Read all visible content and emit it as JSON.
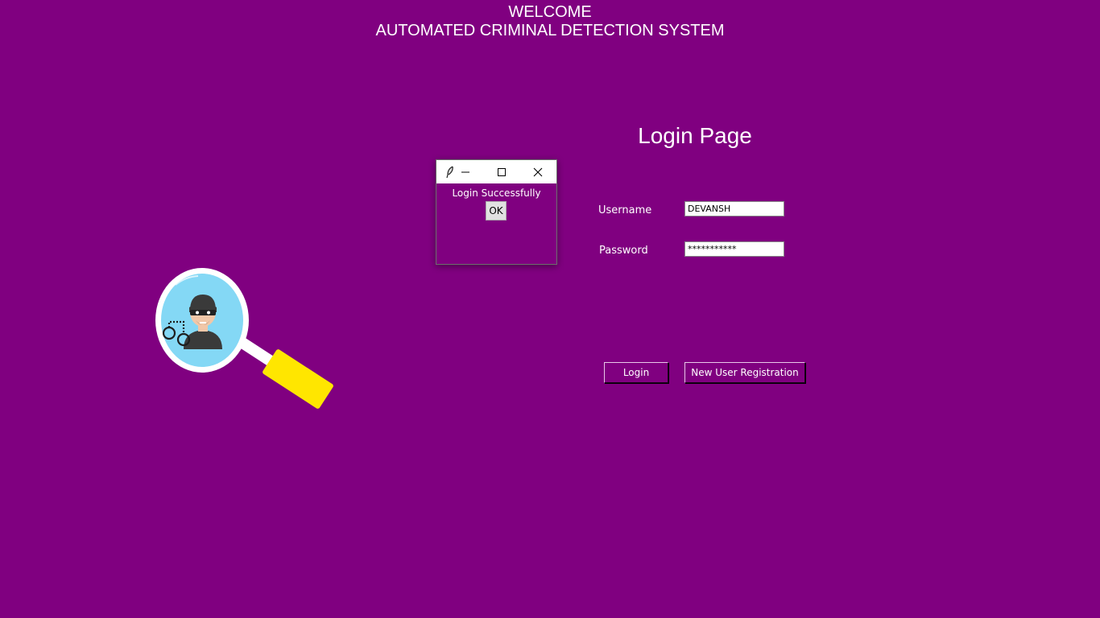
{
  "header": {
    "line1": "WELCOME",
    "line2": "AUTOMATED CRIMINAL DETECTION SYSTEM"
  },
  "login": {
    "title": "Login Page",
    "username_label": "Username",
    "username_value": "DEVANSH",
    "password_label": "Password",
    "password_value": "***********",
    "login_button": "Login",
    "register_button": "New User Registration"
  },
  "dialog": {
    "titlebar_icons": [
      "feather-icon",
      "minimize-icon",
      "maximize-icon",
      "close-icon"
    ],
    "message": "Login Successfully",
    "ok_button": "OK"
  },
  "illustration": {
    "name": "magnifier-criminal-illustration"
  },
  "colors": {
    "background": "#800080",
    "text": "#ffffff",
    "magnifier_handle": "#ffe600",
    "lens_fill": "#84d8f5"
  }
}
